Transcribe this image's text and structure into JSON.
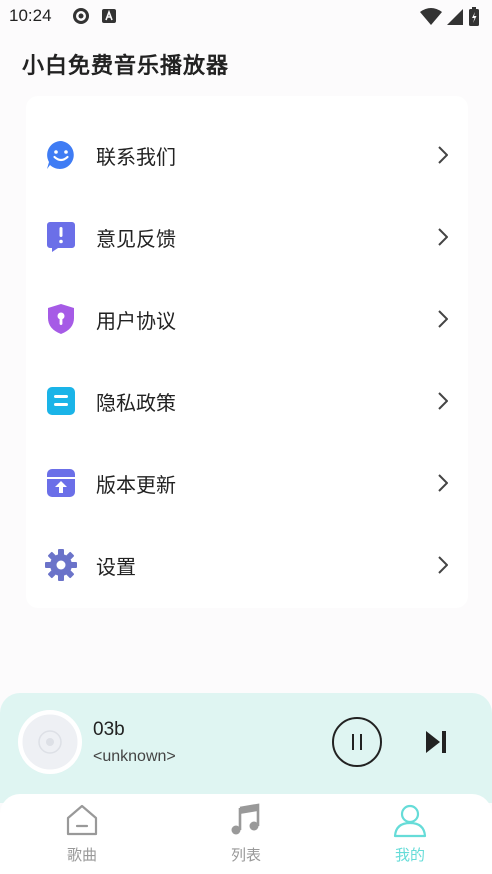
{
  "status_bar": {
    "time": "10:24"
  },
  "header": {
    "title": "小白免费音乐播放器"
  },
  "menu": {
    "items": [
      {
        "label": "联系我们",
        "icon": "smile-chat-icon",
        "color": "#3f7cf4"
      },
      {
        "label": "意见反馈",
        "icon": "feedback-icon",
        "color": "#6b6fe8"
      },
      {
        "label": "用户协议",
        "icon": "shield-lock-icon",
        "color": "#a65be6"
      },
      {
        "label": "隐私政策",
        "icon": "privacy-doc-icon",
        "color": "#1ab4e8"
      },
      {
        "label": "版本更新",
        "icon": "update-box-icon",
        "color": "#6b6fe8"
      },
      {
        "label": "设置",
        "icon": "gear-icon",
        "color": "#6b73c9"
      }
    ]
  },
  "player": {
    "title": "03b",
    "artist": "<unknown>",
    "background": "#dff5f2"
  },
  "bottom_nav": {
    "tabs": [
      {
        "label": "歌曲",
        "icon": "home-icon",
        "active": false
      },
      {
        "label": "列表",
        "icon": "music-note-icon",
        "active": false
      },
      {
        "label": "我的",
        "icon": "user-icon",
        "active": true
      }
    ],
    "active_color": "#66dcd8"
  }
}
